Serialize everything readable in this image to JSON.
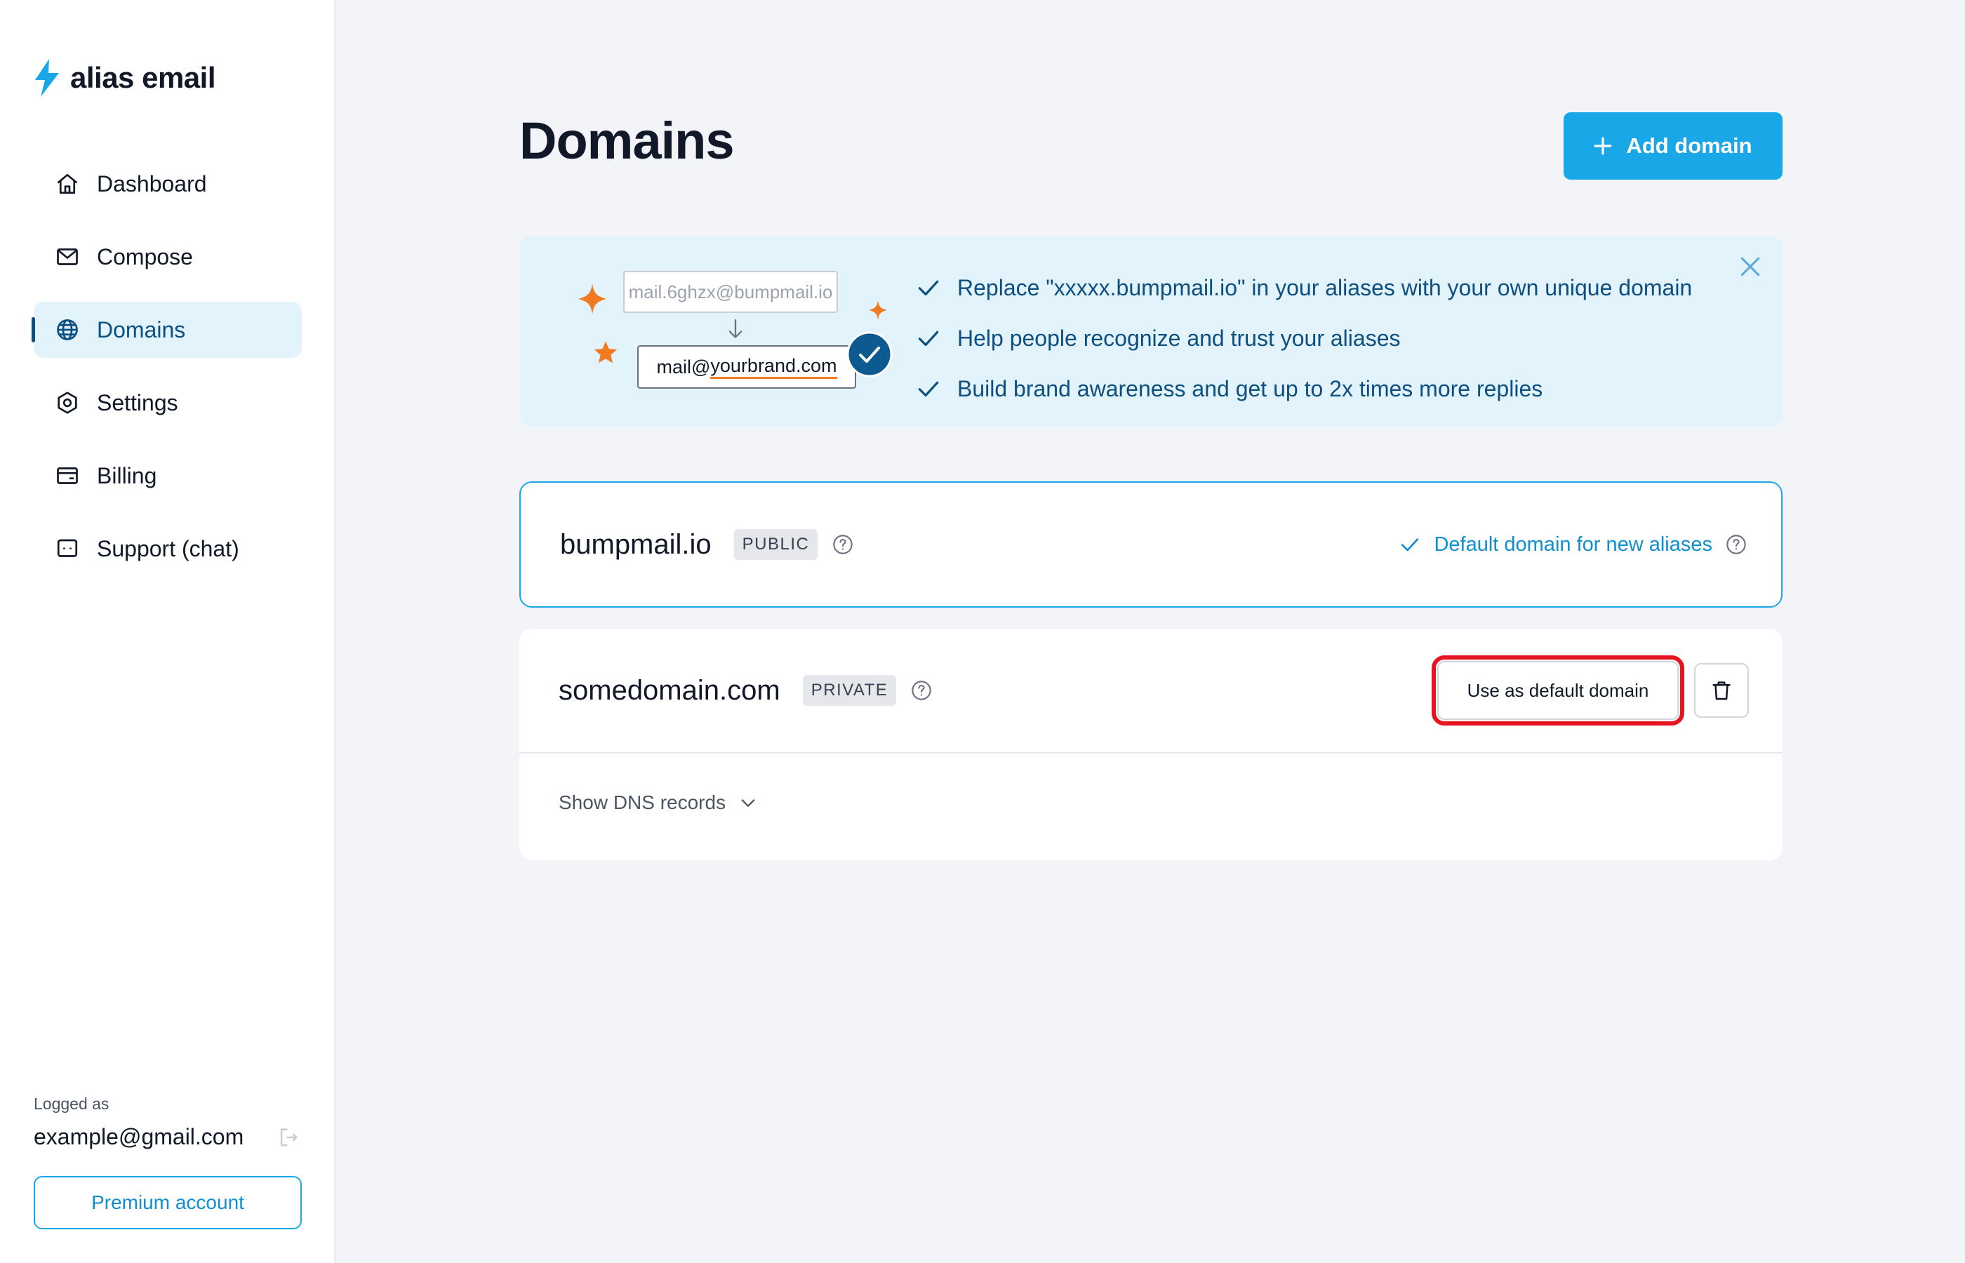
{
  "app": {
    "name": "alias email",
    "accent_color": "#1aa7e8",
    "brand_dark": "#0c4f80"
  },
  "sidebar": {
    "items": [
      {
        "label": "Dashboard",
        "icon": "home-icon"
      },
      {
        "label": "Compose",
        "icon": "mail-icon"
      },
      {
        "label": "Domains",
        "icon": "globe-icon",
        "active": true
      },
      {
        "label": "Settings",
        "icon": "gear-icon"
      },
      {
        "label": "Billing",
        "icon": "card-icon"
      },
      {
        "label": "Support (chat)",
        "icon": "chat-icon"
      }
    ],
    "logged_label": "Logged as",
    "user_email": "example@gmail.com",
    "premium_label": "Premium account"
  },
  "main": {
    "title": "Domains",
    "add_domain_label": "Add domain",
    "promo": {
      "old_address": "mail.6ghzx@bumpmail.io",
      "new_address_prefix": "mail@",
      "new_address_brand": "yourbrand.com",
      "benefits": [
        "Replace \"xxxxx.bumpmail.io\" in your aliases with your own unique domain",
        "Help people recognize and trust your aliases",
        "Build brand awareness and get up to 2x times more replies"
      ]
    },
    "domains": [
      {
        "name": "bumpmail.io",
        "badge": "PUBLIC",
        "default_label": "Default domain for new aliases"
      },
      {
        "name": "somedomain.com",
        "badge": "PRIVATE",
        "use_default_label": "Use as default domain",
        "dns_toggle_label": "Show DNS records"
      }
    ]
  }
}
